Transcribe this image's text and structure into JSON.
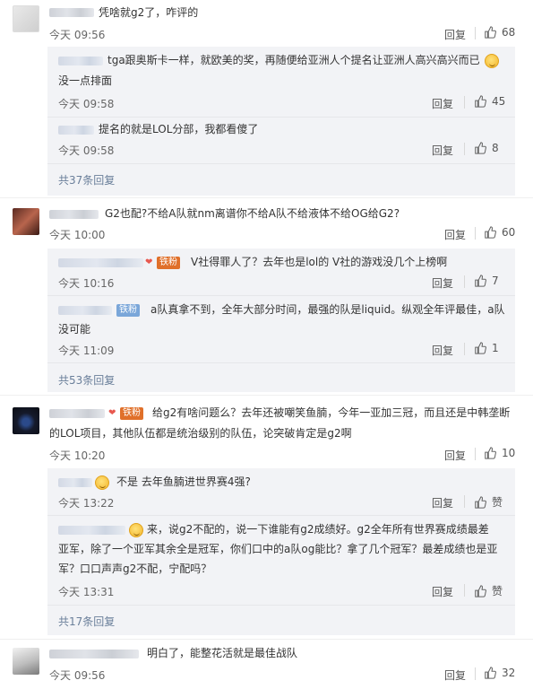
{
  "colors": {
    "accent": "#6a7f9a",
    "fans_badge": "#e0702a",
    "iron_badge": "#7aa6d9"
  },
  "comments": [
    {
      "text": "凭啥就g2了，咋评的",
      "time": "今天 09:56",
      "reply": "回复",
      "likes": "68",
      "subs": [
        {
          "text1": "tga跟奥斯卡一样，就欧美的奖，再随便给亚洲人个提名让亚洲人高兴高兴而已",
          "text2": "没一点排面",
          "time": "今天 09:58",
          "reply": "回复",
          "likes": "45"
        },
        {
          "text1": "提名的就是LOL分部，我都看傻了",
          "time": "今天 09:58",
          "reply": "回复",
          "likes": "8"
        }
      ],
      "more": "共37条回复"
    },
    {
      "text": "G2也配?不给A队就nm离谱你不给A队不给液体不给OG给G2?",
      "time": "今天 10:00",
      "reply": "回复",
      "likes": "60",
      "subs": [
        {
          "badge": "铁粉",
          "text1": "V社得罪人了？去年也是lol的   V社的游戏没几个上榜啊",
          "time": "今天 10:16",
          "reply": "回复",
          "likes": "7"
        },
        {
          "badge": "铁粉",
          "text1": "a队真拿不到，全年大部分时间，最强的队是liquid。纵观全年评最佳，a队",
          "text2": "没可能",
          "time": "今天 11:09",
          "reply": "回复",
          "likes": "1"
        }
      ],
      "more": "共53条回复"
    },
    {
      "badge": "铁粉",
      "text1": "给g2有啥问题么？去年还被嘲笑鱼腩，今年一亚加三冠，而且还是中韩垄断",
      "text2": "的LOL项目，其他队伍都是统治级别的队伍，论突破肯定是g2啊",
      "time": "今天 10:20",
      "reply": "回复",
      "likes": "10",
      "subs": [
        {
          "text1": "不是  去年鱼腩进世界赛4强?",
          "time": "今天 13:22",
          "reply": "回复",
          "likes": "赞"
        },
        {
          "text1": "来，说g2不配的，说一下谁能有g2成绩好。g2全年所有世界赛成绩最差",
          "text2": "亚军，除了一个亚军其余全是冠军，你们口中的a队og能比？拿了几个冠军？最差成绩也是亚",
          "text3": "军？口口声声g2不配，宁配吗？",
          "time": "今天 13:31",
          "reply": "回复",
          "likes": "赞"
        }
      ],
      "more": "共17条回复"
    },
    {
      "text": "明白了，能整花活就是最佳战队",
      "time": "今天 09:56",
      "reply": "回复",
      "likes": "32"
    }
  ]
}
